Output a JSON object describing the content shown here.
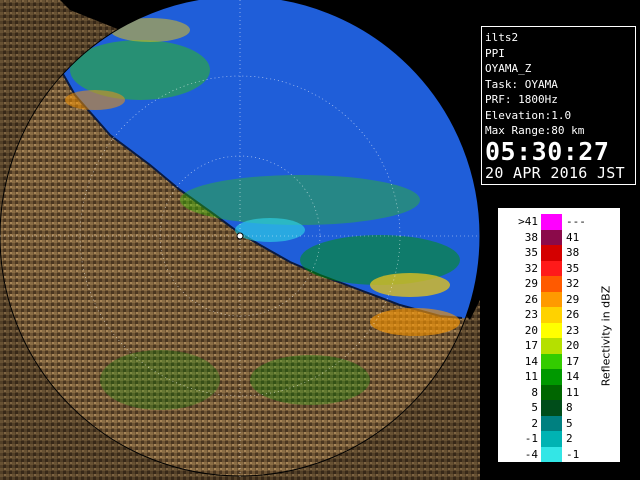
{
  "info": {
    "product": "ilts2",
    "scan_type": "PPI",
    "site": "OYAMA_Z",
    "task": "Task: OYAMA",
    "prf": "PRF: 1800Hz",
    "elevation": "Elevation:1.0",
    "max_range": "Max Range:80 km",
    "time": "05:30:27",
    "date": "20 APR 2016 JST"
  },
  "legend": {
    "title": "Reflectivity in dBZ",
    "rows": [
      {
        "low": ">41",
        "high": "---",
        "color": "#ff00ff"
      },
      {
        "low": "38",
        "high": "41",
        "color": "#8b0a4a"
      },
      {
        "low": "35",
        "high": "38",
        "color": "#d40000"
      },
      {
        "low": "32",
        "high": "35",
        "color": "#ff1a1a"
      },
      {
        "low": "29",
        "high": "32",
        "color": "#ff5a00"
      },
      {
        "low": "26",
        "high": "29",
        "color": "#ff9a00"
      },
      {
        "low": "23",
        "high": "26",
        "color": "#ffd200"
      },
      {
        "low": "20",
        "high": "23",
        "color": "#ffff00"
      },
      {
        "low": "17",
        "high": "20",
        "color": "#b5e000"
      },
      {
        "low": "14",
        "high": "17",
        "color": "#33cc00"
      },
      {
        "low": "11",
        "high": "14",
        "color": "#009900"
      },
      {
        "low": "8",
        "high": "11",
        "color": "#006600"
      },
      {
        "low": "5",
        "high": "8",
        "color": "#004d1a"
      },
      {
        "low": "2",
        "high": "5",
        "color": "#008080"
      },
      {
        "low": "-1",
        "high": "2",
        "color": "#00b3b3"
      },
      {
        "low": "-4",
        "high": "-1",
        "color": "#33e6e6"
      }
    ]
  },
  "colors": {
    "sea": "#1f5ed9",
    "land": "#6b5132",
    "background": "#000000",
    "range_ring": "#ffffff"
  },
  "icons": {
    "radar_site": "radar-site-icon"
  }
}
